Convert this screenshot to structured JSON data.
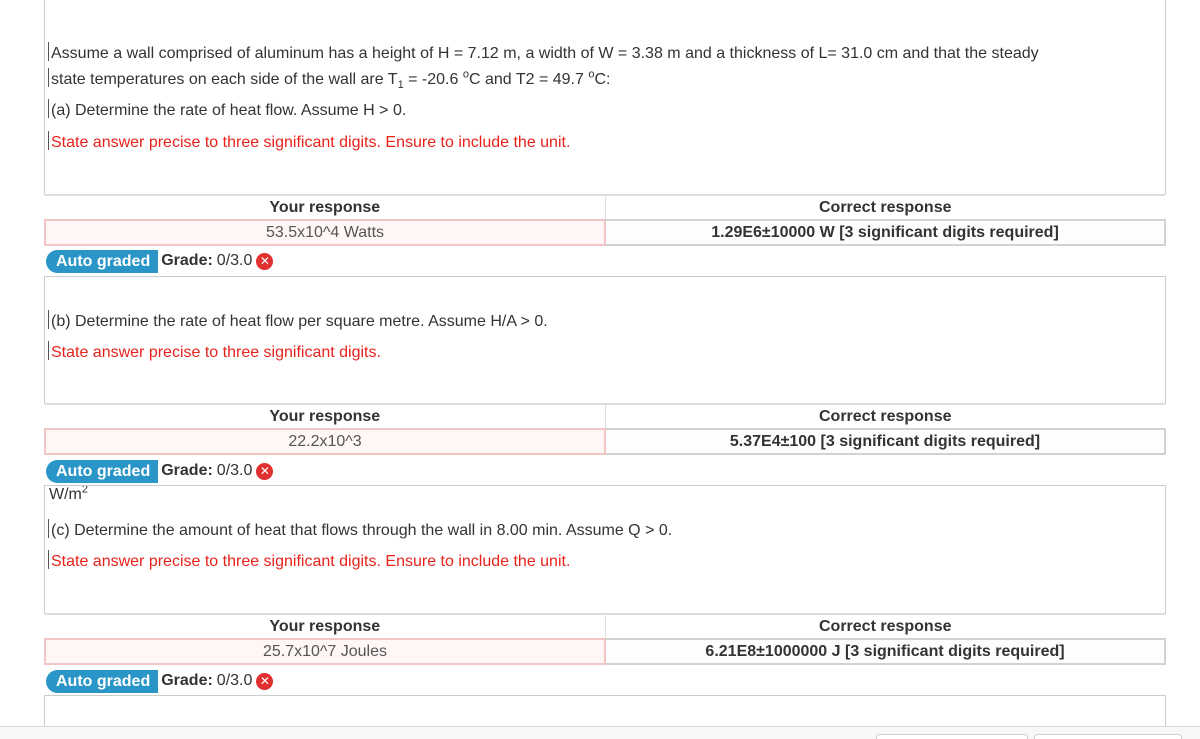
{
  "question": {
    "intro_line1": "Assume a wall comprised of aluminum has a height of H = 7.12 m, a width of W = 3.38 m and a thickness of L= 31.0 cm and that the steady",
    "intro_line2_pre": "state temperatures on each side of the wall are T",
    "intro_line2_sub": "1",
    "intro_line2_mid": " = -20.6 ",
    "intro_line2_deg1": "o",
    "intro_line2_mid2": "C and T2 = 49.7 ",
    "intro_line2_deg2": "o",
    "intro_line2_end": "C:"
  },
  "parts": [
    {
      "prompt": "(a) Determine the rate of heat flow. Assume H > 0.",
      "instruction": "State answer precise to three significant digits. Ensure to include the unit.",
      "your_response_header": "Your response",
      "correct_response_header": "Correct response",
      "your_response": "53.5x10^4 Watts",
      "correct_response": "1.29E6±10000 W [3 significant digits required]",
      "badge": "Auto graded",
      "grade_label": "Grade:",
      "grade_value": "0/3.0"
    },
    {
      "prompt": "(b) Determine the rate of heat flow per square metre. Assume H/A > 0.",
      "instruction": "State answer precise to three significant digits.",
      "your_response_header": "Your response",
      "correct_response_header": "Correct response",
      "your_response": "22.2x10^3",
      "correct_response": "5.37E4±100 [3 significant digits required]",
      "badge": "Auto graded",
      "grade_label": "Grade:",
      "grade_value": "0/3.0",
      "unit_base": "W/m",
      "unit_sup": "2"
    },
    {
      "prompt": "(c) Determine the amount of heat that flows through the wall in 8.00 min. Assume Q > 0.",
      "instruction": "State answer precise to three significant digits. Ensure to include the unit.",
      "your_response_header": "Your response",
      "correct_response_header": "Correct response",
      "your_response": "25.7x10^7 Joules",
      "correct_response": "6.21E8±1000000 J [3 significant digits required]",
      "badge": "Auto graded",
      "grade_label": "Grade:",
      "grade_value": "0/3.0"
    }
  ],
  "icons": {
    "wrong": "x-circle-icon"
  },
  "colors": {
    "instruction_red": "#e8221b",
    "badge_blue": "#2a96c8",
    "wrong_red": "#e03030",
    "your_response_bg": "#fff6f6"
  }
}
